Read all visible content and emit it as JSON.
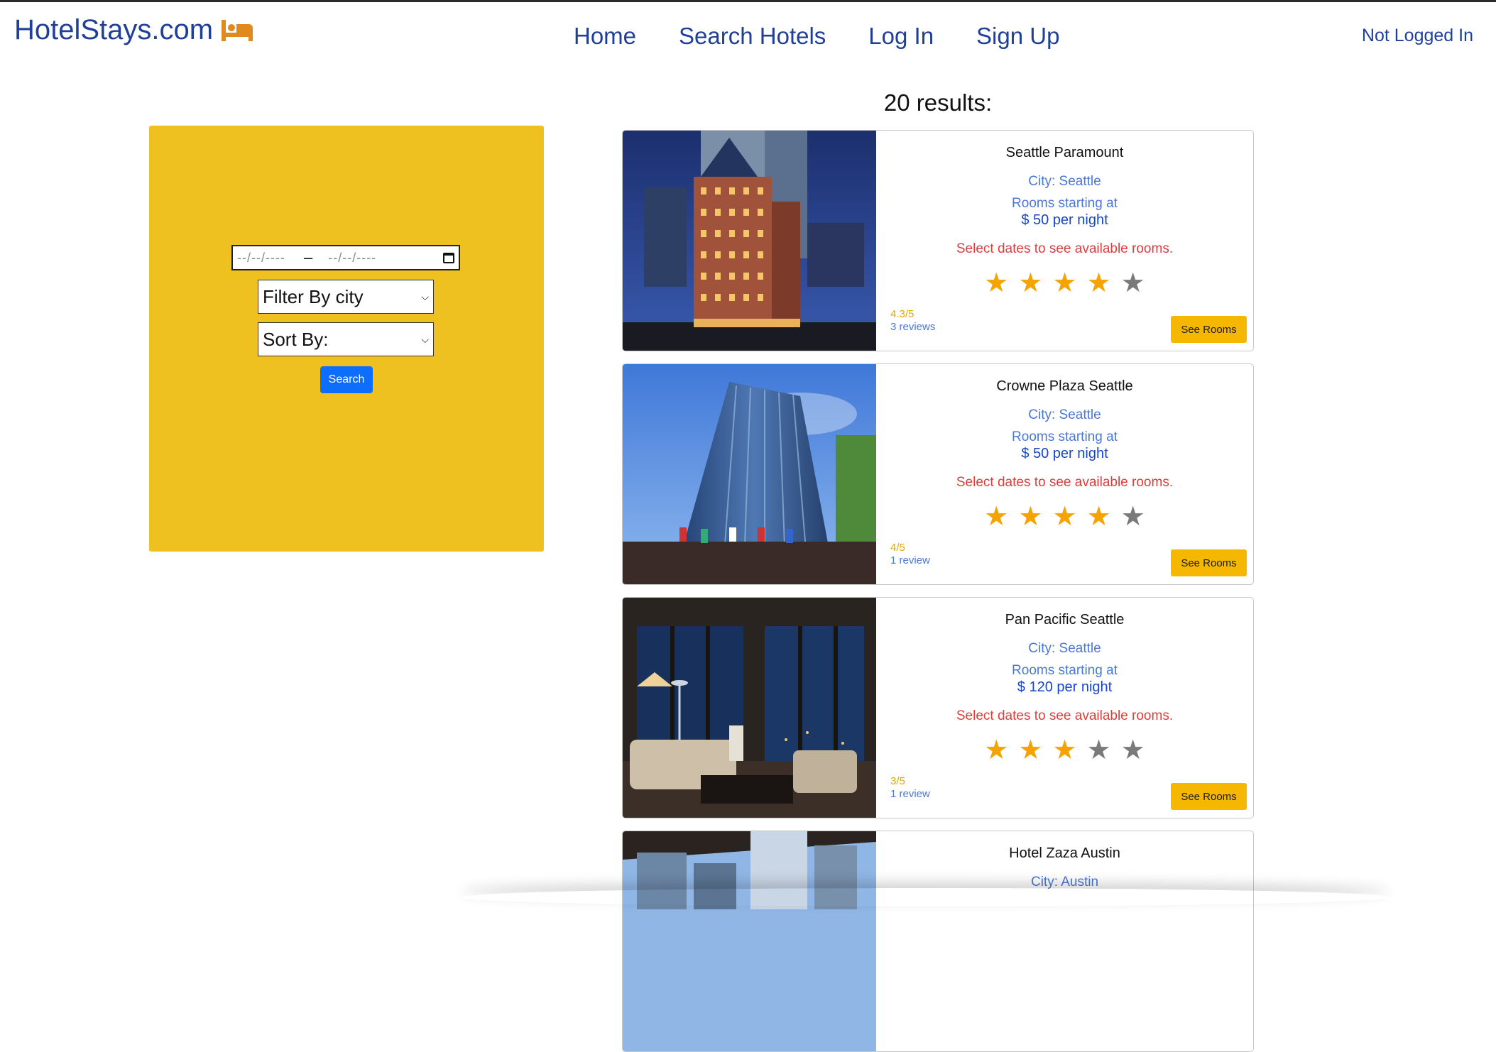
{
  "header": {
    "brand": "HotelStays.com",
    "nav": [
      "Home",
      "Search Hotels",
      "Log In",
      "Sign Up"
    ],
    "status": "Not Logged In"
  },
  "results_title": "20 results:",
  "search_panel": {
    "date_start_placeholder": "--/--/----",
    "date_end_placeholder": "--/--/----",
    "date_separator": "–",
    "filter_select": "Filter By city",
    "sort_select": "Sort By:",
    "search_button": "Search"
  },
  "hotels": [
    {
      "name": "Seattle Paramount",
      "city": "City: Seattle",
      "starting_label": "Rooms starting at",
      "price": "$ 50 per night",
      "notice": "Select dates to see available rooms.",
      "stars": 4,
      "score": "4.3/5",
      "reviews": "3 reviews",
      "button": "See Rooms"
    },
    {
      "name": "Crowne Plaza Seattle",
      "city": "City: Seattle",
      "starting_label": "Rooms starting at",
      "price": "$ 50 per night",
      "notice": "Select dates to see available rooms.",
      "stars": 4,
      "score": "4/5",
      "reviews": "1 review",
      "button": "See Rooms"
    },
    {
      "name": "Pan Pacific Seattle",
      "city": "City: Seattle",
      "starting_label": "Rooms starting at",
      "price": "$ 120 per night",
      "notice": "Select dates to see available rooms.",
      "stars": 3,
      "score": "3/5",
      "reviews": "1 review",
      "button": "See Rooms"
    },
    {
      "name": "Hotel Zaza Austin",
      "city": "City: Austin"
    }
  ],
  "colors": {
    "brand_blue": "#1f3f99",
    "sidebar_yellow": "#eec020",
    "star_on": "#f5a300",
    "star_off": "#7a7a7a",
    "button_yellow": "#f5b700",
    "notice_red": "#e23b3b"
  },
  "icons": [
    "bed-icon",
    "calendar-icon",
    "chevron-down-icon",
    "star-icon"
  ]
}
